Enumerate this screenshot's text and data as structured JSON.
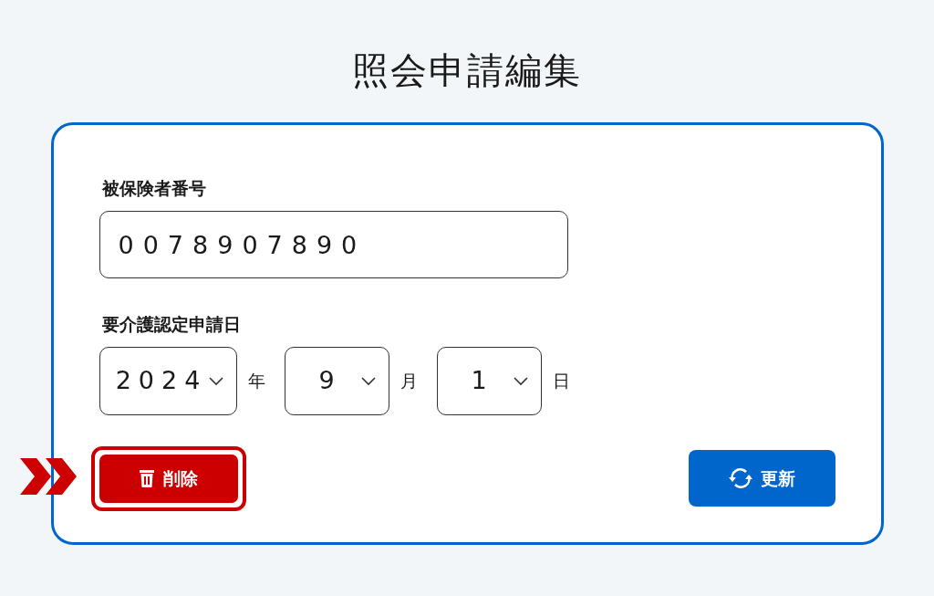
{
  "title": "照会申請編集",
  "insured_number": {
    "label": "被保険者番号",
    "value": "0078907890"
  },
  "application_date": {
    "label": "要介護認定申請日",
    "parts": [
      {
        "value": "2024",
        "unit": "年"
      },
      {
        "value": "9",
        "unit": "月"
      },
      {
        "value": "1",
        "unit": "日"
      }
    ]
  },
  "buttons": [
    {
      "kind": "delete",
      "label": "削除",
      "highlighted": true
    },
    {
      "kind": "update",
      "label": "更新",
      "highlighted": false
    }
  ]
}
